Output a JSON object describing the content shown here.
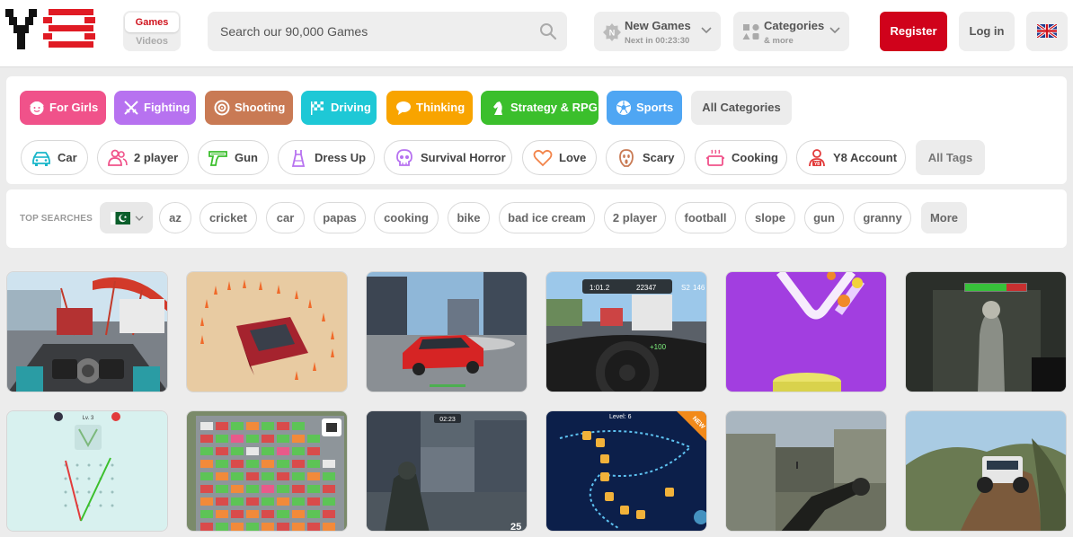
{
  "header": {
    "mode_switch": {
      "games": "Games",
      "videos": "Videos"
    },
    "search": {
      "placeholder": "Search our 90,000 Games",
      "icon": "search-icon"
    },
    "new_games": {
      "title": "New Games",
      "subtitle": "Next in 00:23:30",
      "icon": "new-badge-icon"
    },
    "categories": {
      "title": "Categories",
      "subtitle": "& more",
      "icon": "grid-shapes-icon"
    },
    "register": "Register",
    "login": "Log in",
    "language_icon": "uk-flag-icon"
  },
  "category_buttons": [
    {
      "label": "For Girls",
      "icon": "girl-face-icon",
      "color": "#f0528a"
    },
    {
      "label": "Fighting",
      "icon": "crossed-swords-icon",
      "color": "#b772f0"
    },
    {
      "label": "Shooting",
      "icon": "target-icon",
      "color": "#c97a54"
    },
    {
      "label": "Driving",
      "icon": "checkered-flag-icon",
      "color": "#1ec8d6"
    },
    {
      "label": "Thinking",
      "icon": "speech-bubble-icon",
      "color": "#f8a400"
    },
    {
      "label": "Strategy & RPG",
      "icon": "chess-knight-icon",
      "color": "#3bbf2c"
    },
    {
      "label": "Sports",
      "icon": "soccer-ball-icon",
      "color": "#4fa6f3"
    },
    {
      "label": "All Categories"
    }
  ],
  "tag_buttons": [
    {
      "label": "Car",
      "icon": "car-icon",
      "color": "#19b6c9"
    },
    {
      "label": "2 player",
      "icon": "two-people-icon",
      "color": "#f0528a"
    },
    {
      "label": "Gun",
      "icon": "gun-icon",
      "color": "#3bbf2c"
    },
    {
      "label": "Dress Up",
      "icon": "dress-icon",
      "color": "#b772f0"
    },
    {
      "label": "Survival Horror",
      "icon": "skull-icon",
      "color": "#b772f0"
    },
    {
      "label": "Love",
      "icon": "heart-icon",
      "color": "#f2844a"
    },
    {
      "label": "Scary",
      "icon": "scream-face-icon",
      "color": "#c97a54"
    },
    {
      "label": "Cooking",
      "icon": "cooking-pot-icon",
      "color": "#f0528a"
    },
    {
      "label": "Y8 Account",
      "icon": "account-icon",
      "color": "#e23b3b"
    },
    {
      "label": "All Tags"
    }
  ],
  "top_searches": {
    "label": "TOP SEARCHES",
    "country_flag_icon": "pakistan-flag-icon",
    "items": [
      "az",
      "cricket",
      "car",
      "papas",
      "cooking",
      "bike",
      "bad ice cream",
      "2 player",
      "football",
      "slope",
      "gun",
      "granny"
    ],
    "more": "More"
  },
  "thumbnails": {
    "row1": [
      {
        "name": "motorbike-highway-thumbnail"
      },
      {
        "name": "car-parking-cones-thumbnail"
      },
      {
        "name": "drift-car-city-thumbnail"
      },
      {
        "name": "car-interior-traffic-thumbnail",
        "hud": {
          "time": "1:01.2",
          "score": "22347",
          "gear": "S2",
          "speed": "146",
          "bonus": "+100"
        }
      },
      {
        "name": "helix-ball-thumbnail"
      },
      {
        "name": "granny-horror-thumbnail"
      }
    ],
    "row2": [
      {
        "name": "line-puzzle-thumbnail",
        "level": "Lv. 3"
      },
      {
        "name": "parking-jam-thumbnail"
      },
      {
        "name": "soldier-shooter-thumbnail",
        "timer": "02:23",
        "ammo": "25"
      },
      {
        "name": "space-bubble-thumbnail",
        "level": "Level: 6",
        "badge": "NEW"
      },
      {
        "name": "sniper-rifle-thumbnail"
      },
      {
        "name": "offroad-truck-thumbnail"
      }
    ]
  }
}
